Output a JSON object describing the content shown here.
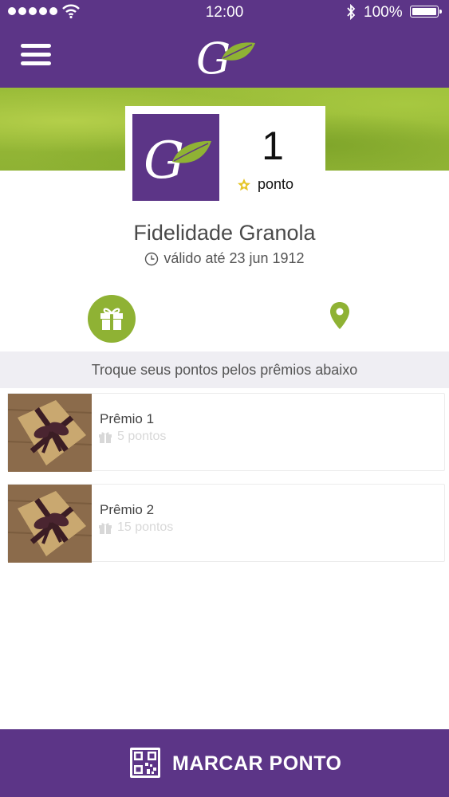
{
  "status_bar": {
    "time": "12:00",
    "battery_percent": "100%",
    "signal_bars": 5
  },
  "nav": {
    "logo_text": "G"
  },
  "card": {
    "logo_text": "G",
    "points_value": "1",
    "points_label": "ponto"
  },
  "program": {
    "title": "Fidelidade Granola",
    "validity": "válido até 23 jun 1912"
  },
  "rewards_section": {
    "header": "Troque seus pontos pelos prêmios abaixo",
    "items": [
      {
        "name": "Prêmio 1",
        "cost": "5 pontos"
      },
      {
        "name": "Prêmio 2",
        "cost": "15 pontos"
      }
    ]
  },
  "bottom_action": {
    "label": "MARCAR PONTO"
  },
  "colors": {
    "brand_purple": "#5c3587",
    "brand_green": "#8fb234",
    "section_bg": "#efeef3"
  },
  "icons": [
    "signal-icon",
    "wifi-icon",
    "bluetooth-icon",
    "battery-icon",
    "menu-icon",
    "leaf-icon",
    "star-icon",
    "clock-icon",
    "gift-icon",
    "map-pin-icon",
    "qr-code-icon"
  ]
}
